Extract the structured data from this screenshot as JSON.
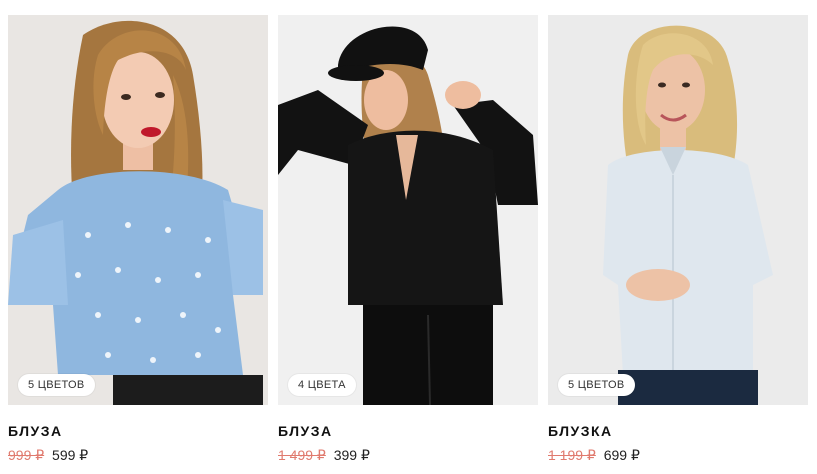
{
  "products": [
    {
      "colors_badge": "5 ЦВЕТОВ",
      "title": "БЛУЗА",
      "old_price": "999 ₽",
      "price": "599 ₽",
      "image_desc": "woman in light blue printed blouse with ruffled sleeves"
    },
    {
      "colors_badge": "4 ЦВЕТА",
      "title": "БЛУЗА",
      "old_price": "1 499 ₽",
      "price": "399 ₽",
      "image_desc": "woman in black wrap blouse and black cap"
    },
    {
      "colors_badge": "5 ЦВЕТОВ",
      "title": "БЛУЗКА",
      "old_price": "1 199 ₽",
      "price": "699 ₽",
      "image_desc": "blonde woman in white fitted shirt"
    }
  ],
  "colors": {
    "old_price": "#e07a6e",
    "title": "#111111",
    "badge_bg": "#ffffff"
  }
}
